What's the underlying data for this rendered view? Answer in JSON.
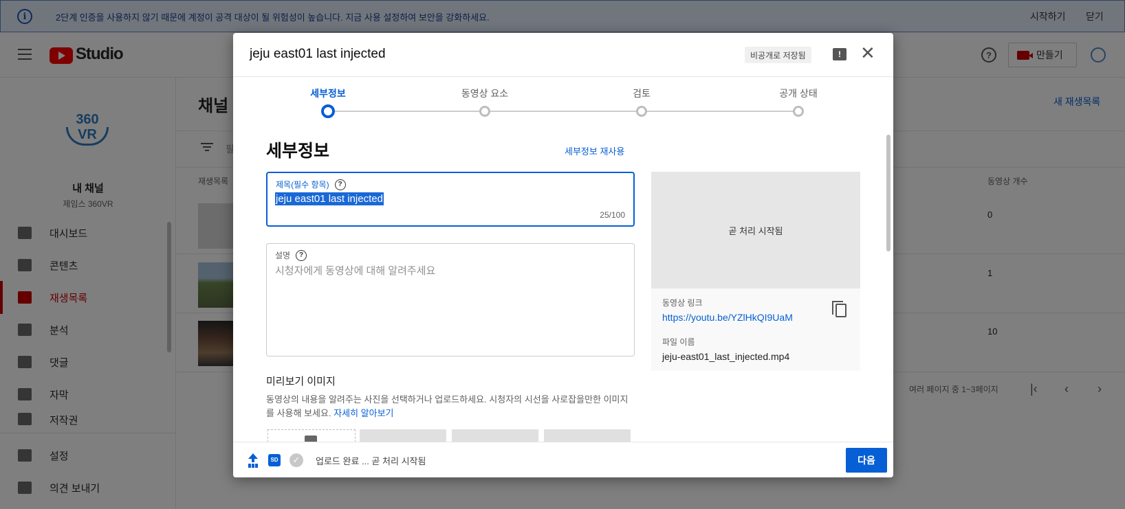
{
  "banner": {
    "message": "2단계 인증을 사용하지 않기 때문에 계정이 공격 대상이 될 위험성이 높습니다. 지금 사용 설정하여 보안을 강화하세요.",
    "start": "시작하기",
    "close": "닫기"
  },
  "header": {
    "logo_text": "Studio",
    "create_label": "만들기"
  },
  "sidebar": {
    "logo_top": "360",
    "logo_bottom": "VR",
    "channel_name": "내 채널",
    "channel_sub": "제임스 360VR",
    "items": [
      {
        "label": "대시보드"
      },
      {
        "label": "콘텐츠"
      },
      {
        "label": "재생목록"
      },
      {
        "label": "분석"
      },
      {
        "label": "댓글"
      },
      {
        "label": "자막"
      },
      {
        "label": "저작권"
      }
    ],
    "settings": "설정",
    "feedback": "의견 보내기"
  },
  "background": {
    "title": "채널",
    "new_playlist": "새 재생목록",
    "filter_text": "필",
    "col_playlist": "재생목록",
    "col_count": "동영상 개수",
    "rows": [
      {
        "count": "0"
      },
      {
        "count": "1"
      },
      {
        "count": "10"
      }
    ],
    "pager": "여러 페이지 중 1~3페이지"
  },
  "dialog": {
    "title": "jeju east01 last injected",
    "saved_badge": "비공개로 저장됨",
    "steps": [
      {
        "label": "세부정보",
        "active": true
      },
      {
        "label": "동영상 요소",
        "active": false
      },
      {
        "label": "검토",
        "active": false
      },
      {
        "label": "공개 상태",
        "active": false
      }
    ],
    "section_title": "세부정보",
    "reuse_link": "세부정보 재사용",
    "title_field": {
      "label": "제목(필수 항목)",
      "value": "jeju east01 last injected",
      "count": "25/100"
    },
    "desc_field": {
      "label": "설명",
      "placeholder": "시청자에게 동영상에 대해 알려주세요"
    },
    "thumbnail": {
      "title": "미리보기 이미지",
      "desc": "동영상의 내용을 알려주는 사진을 선택하거나 업로드하세요. 시청자의 시선을 사로잡을만한 이미지를 사용해 보세요.",
      "learn_more": "자세히 알아보기"
    },
    "preview": {
      "status": "곧 처리 시작됨",
      "link_label": "동영상 링크",
      "link": "https://youtu.be/YZlHkQI9UaM",
      "file_label": "파일 이름",
      "file_name": "jeju-east01_last_injected.mp4"
    },
    "footer": {
      "hd_badge": "SD",
      "status": "업로드 완료 ... 곧 처리 시작됨",
      "next": "다음"
    }
  },
  "colors": {
    "accent": "#065fd4",
    "brand_red": "#ff0000",
    "active_nav": "#cc0000"
  }
}
